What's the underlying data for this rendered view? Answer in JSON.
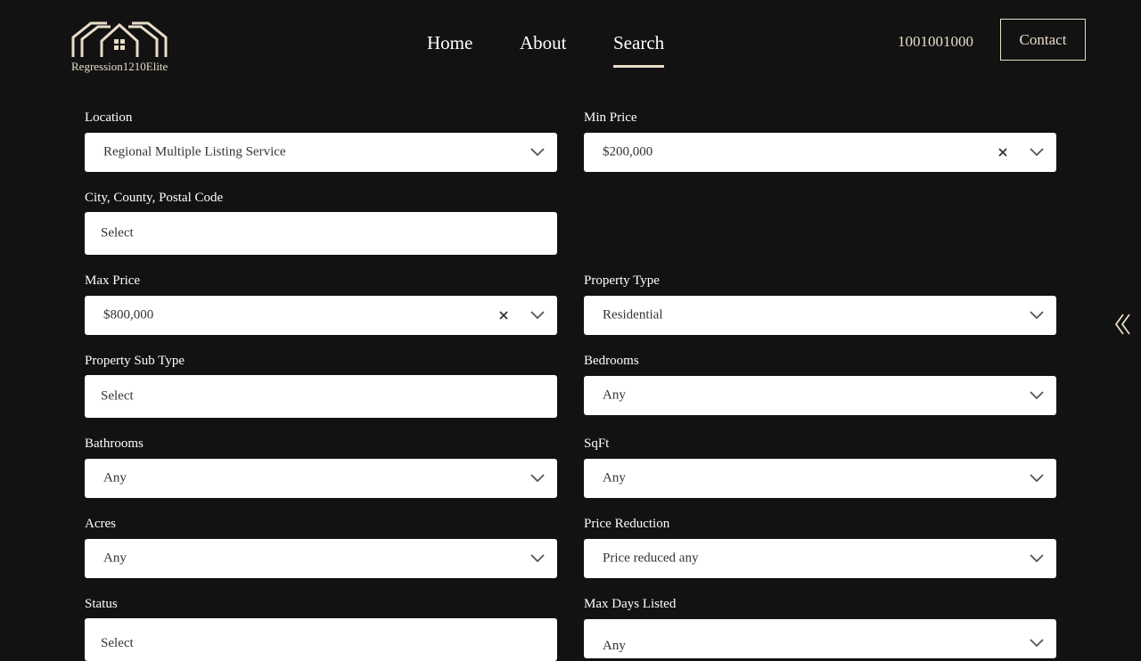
{
  "brand": {
    "name": "Regression1210Elite"
  },
  "nav": {
    "items": [
      {
        "label": "Home"
      },
      {
        "label": "About"
      },
      {
        "label": "Search"
      }
    ],
    "active": "Search"
  },
  "header": {
    "phone": "1001001000",
    "contact_label": "Contact"
  },
  "filters": {
    "location": {
      "label": "Location",
      "value": "Regional Multiple Listing Service"
    },
    "min_price": {
      "label": "Min Price",
      "value": "$200,000"
    },
    "city": {
      "label": "City, County, Postal Code",
      "placeholder": "Select"
    },
    "max_price": {
      "label": "Max Price",
      "value": "$800,000"
    },
    "property_type": {
      "label": "Property Type",
      "value": "Residential"
    },
    "property_sub_type": {
      "label": "Property Sub Type",
      "placeholder": "Select"
    },
    "bedrooms": {
      "label": "Bedrooms",
      "value": "Any"
    },
    "bathrooms": {
      "label": "Bathrooms",
      "value": "Any"
    },
    "sqft": {
      "label": "SqFt",
      "value": "Any"
    },
    "acres": {
      "label": "Acres",
      "value": "Any"
    },
    "price_reduction": {
      "label": "Price Reduction",
      "value": "Price reduced any"
    },
    "status": {
      "label": "Status",
      "placeholder": "Select"
    },
    "max_days_listed": {
      "label": "Max Days Listed",
      "value": "Any"
    }
  },
  "colors": {
    "background": "#121212",
    "accent": "#e8dcc8",
    "field_bg": "#ffffff"
  },
  "icons": {
    "chevron": "chevron-down-icon",
    "clear": "close-icon",
    "side_toggle": "double-chevron-left-icon",
    "logo": "house-logo-icon"
  }
}
